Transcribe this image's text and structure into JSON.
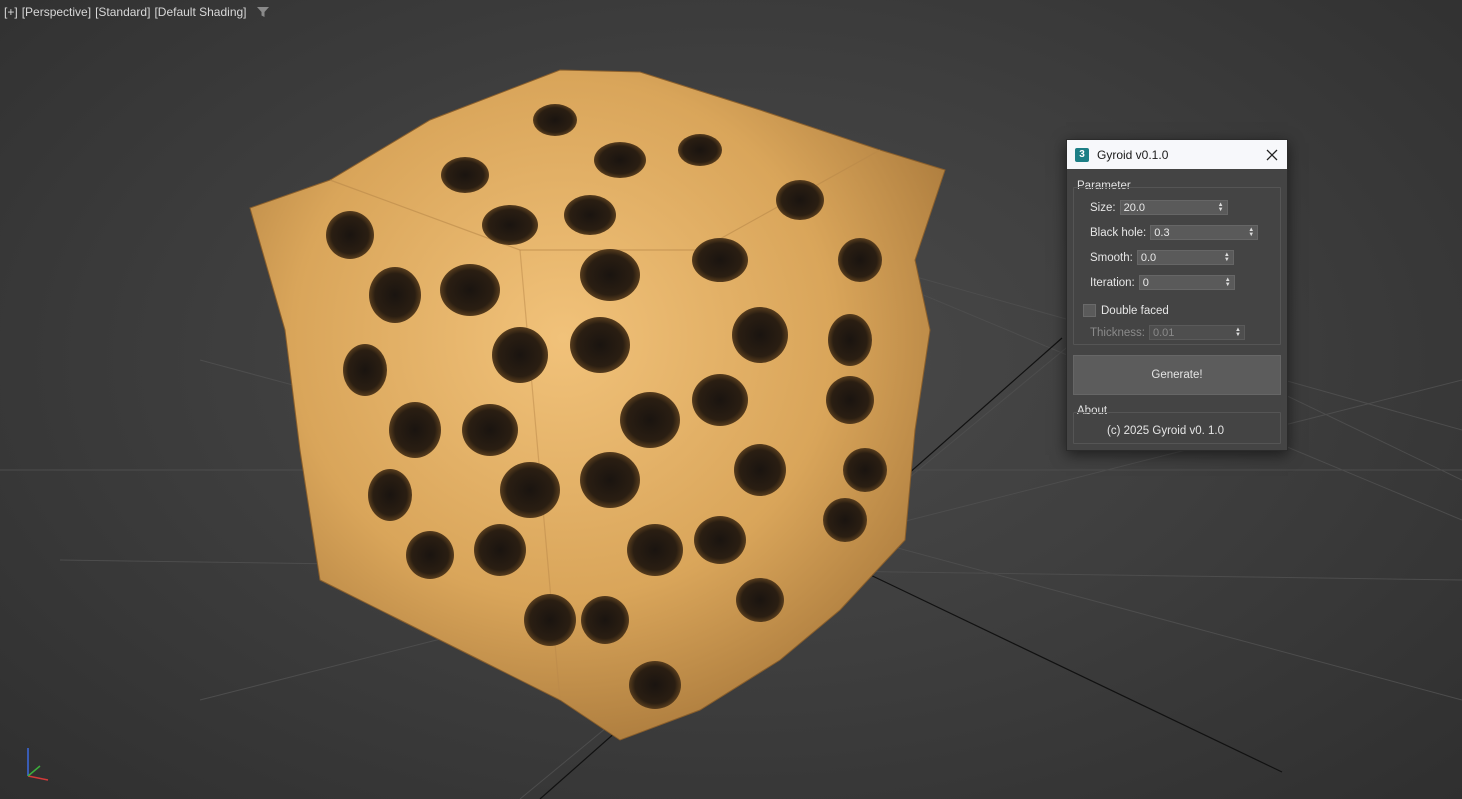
{
  "viewport": {
    "labels": [
      "[+]",
      "[Perspective]",
      "[Standard]",
      "[Default Shading]"
    ],
    "filter_icon": "funnel-icon",
    "object_color": "#e0aa5e",
    "background_color": "#3f3f3f"
  },
  "dialog": {
    "title": "Gyroid v0.1.0",
    "app_icon_text": "3",
    "close_icon": "close-icon",
    "parameter_group": {
      "label": "Parameter",
      "size": {
        "label": "Size:",
        "value": "20.0"
      },
      "black_hole": {
        "label": "Black hole:",
        "value": "0.3"
      },
      "smooth": {
        "label": "Smooth:",
        "value": "0.0"
      },
      "iteration": {
        "label": "Iteration:",
        "value": "0"
      },
      "double_faced": {
        "label": "Double faced",
        "checked": false
      },
      "thickness": {
        "label": "Thickness:",
        "value": "0.01",
        "enabled": false
      }
    },
    "generate_button": "Generate!",
    "about_group": {
      "label": "About",
      "text": "(c) 2025 Gyroid v0. 1.0"
    }
  }
}
